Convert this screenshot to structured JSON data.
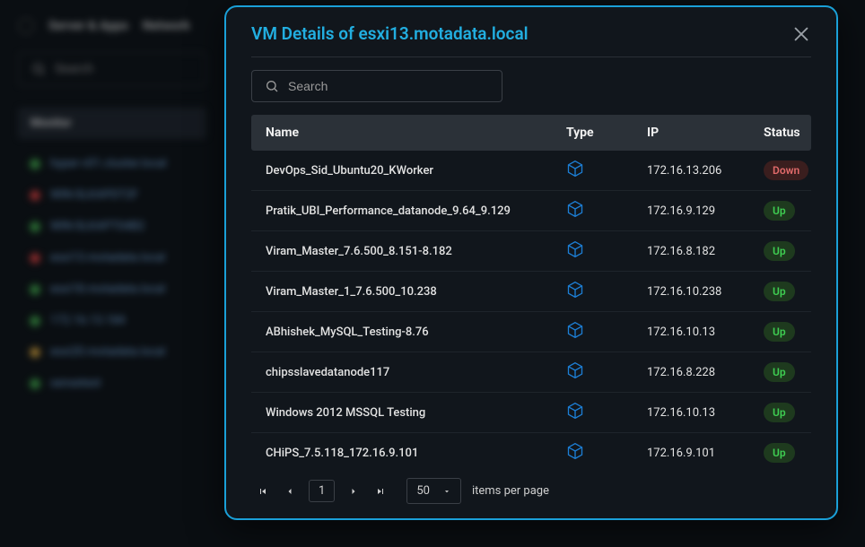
{
  "background": {
    "tabs": [
      "Server & Apps",
      "Network"
    ],
    "search_placeholder": "Search",
    "section_label": "Monitor",
    "items": [
      {
        "dot": "green",
        "label": "hyper-v01.cluster.local"
      },
      {
        "dot": "red",
        "label": "WIN-SLKAPDT2F"
      },
      {
        "dot": "green",
        "label": "WIN-SLKAPT04B2"
      },
      {
        "dot": "red",
        "label": "esxi13.motadata.local"
      },
      {
        "dot": "green",
        "label": "esxi18.motadata.local"
      },
      {
        "dot": "green",
        "label": "172.16.13.184"
      },
      {
        "dot": "yellow",
        "label": "esxi20.motadata.local"
      },
      {
        "dot": "green",
        "label": "sensetest"
      }
    ]
  },
  "modal": {
    "title": "VM Details of esxi13.motadata.local",
    "search_placeholder": "Search",
    "columns": {
      "name": "Name",
      "type": "Type",
      "ip": "IP",
      "status": "Status"
    },
    "rows": [
      {
        "name": "DevOps_Sid_Ubuntu20_KWorker",
        "ip": "172.16.13.206",
        "status": "Down"
      },
      {
        "name": "Pratik_UBI_Performance_datanode_9.64_9.129",
        "ip": "172.16.9.129",
        "status": "Up"
      },
      {
        "name": "Viram_Master_7.6.500_8.151-8.182",
        "ip": "172.16.8.182",
        "status": "Up"
      },
      {
        "name": "Viram_Master_1_7.6.500_10.238",
        "ip": "172.16.10.238",
        "status": "Up"
      },
      {
        "name": "ABhishek_MySQL_Testing-8.76",
        "ip": "172.16.10.13",
        "status": "Up"
      },
      {
        "name": "chipsslavedatanode117",
        "ip": "172.16.8.228",
        "status": "Up"
      },
      {
        "name": "Windows 2012 MSSQL Testing",
        "ip": "172.16.10.13",
        "status": "Up"
      },
      {
        "name": "CHiPS_7.5.118_172.16.9.101",
        "ip": "172.16.9.101",
        "status": "Up"
      }
    ],
    "pager": {
      "page": "1",
      "page_size": "50",
      "label": "items per page"
    }
  }
}
